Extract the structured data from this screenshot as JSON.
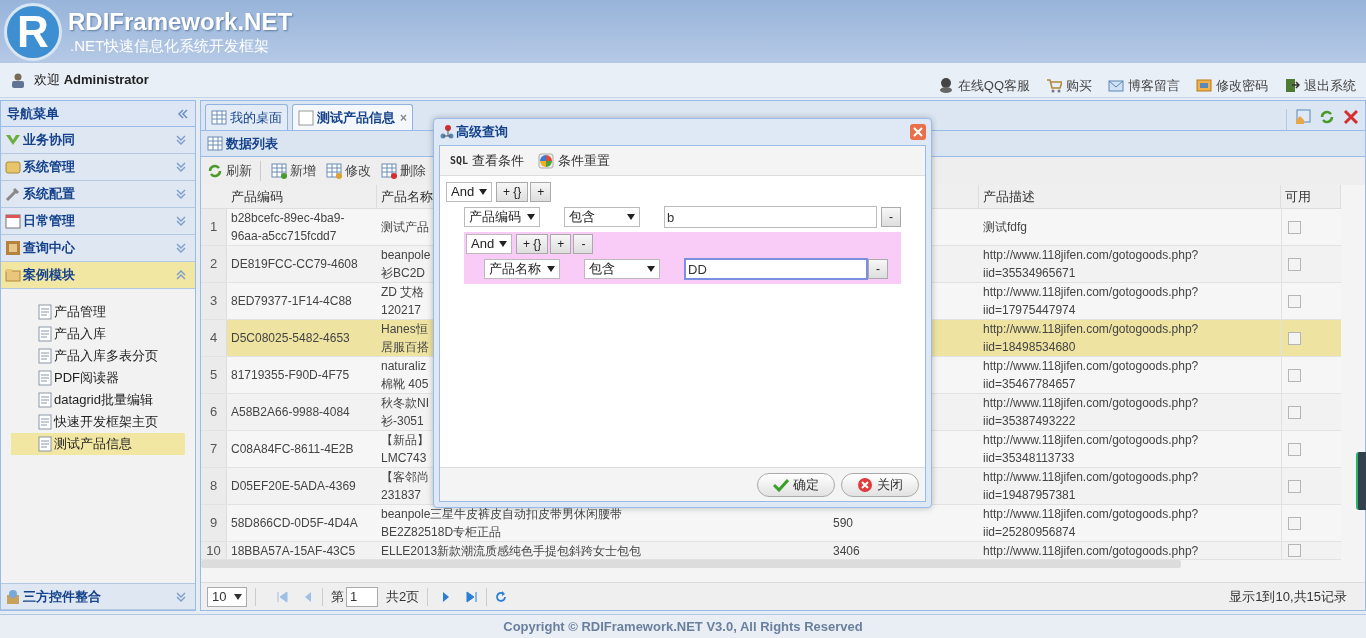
{
  "header": {
    "logo_letter": "R",
    "title": "RDIFramework.NET",
    "subtitle": ".NET快速信息化系统开发框架"
  },
  "welcome": "欢迎 **Administrator**",
  "top_links": [
    {
      "label": "在线QQ客服",
      "kind": "person"
    },
    {
      "label": "购买",
      "kind": "cart"
    },
    {
      "label": "博客留言",
      "kind": "mail"
    },
    {
      "label": "修改密码",
      "kind": "key"
    },
    {
      "label": "退出系统",
      "kind": "exit"
    }
  ],
  "sidebar": {
    "title": "导航菜单",
    "sections": [
      {
        "label": "业务协同",
        "expanded": false,
        "selected": false
      },
      {
        "label": "系统管理",
        "expanded": false,
        "selected": false
      },
      {
        "label": "系统配置",
        "expanded": false,
        "selected": false
      },
      {
        "label": "日常管理",
        "expanded": false,
        "selected": false
      },
      {
        "label": "查询中心",
        "expanded": false,
        "selected": false
      },
      {
        "label": "案例模块",
        "expanded": true,
        "selected": true,
        "items": [
          {
            "label": "产品管理",
            "selected": false
          },
          {
            "label": "产品入库",
            "selected": false
          },
          {
            "label": "产品入库多表分页",
            "selected": false
          },
          {
            "label": "PDF阅读器",
            "selected": false
          },
          {
            "label": "datagrid批量编辑",
            "selected": false
          },
          {
            "label": "快速开发框架主页",
            "selected": false
          },
          {
            "label": "测试产品信息",
            "selected": true
          }
        ]
      },
      {
        "label": "三方控件整合",
        "expanded": false,
        "selected": false
      }
    ]
  },
  "tabs": [
    {
      "label": "我的桌面",
      "selected": false
    },
    {
      "label": "测试产品信息",
      "selected": true,
      "close": "×"
    }
  ],
  "panel_title": "数据列表",
  "toolbar": [
    "刷新",
    "新增",
    "修改",
    "删除"
  ],
  "table": {
    "columns": [
      "产品编码",
      "产品名称",
      "",
      "",
      "产品描述",
      "可用"
    ],
    "rows": [
      {
        "num": "1",
        "code": [
          "b28bcefc-89ec-4ba9-",
          "96aa-a5cc715fcdd7"
        ],
        "name": [
          "测试产品"
        ],
        "column_4": "",
        "desc": [
          "测试fdfg"
        ],
        "checked": false,
        "selected": false
      },
      {
        "num": "2",
        "code": [
          "DE819FCC-CC79-4608"
        ],
        "name": [
          "beanpole",
          "衫BC2D"
        ],
        "column_4": "",
        "desc": [
          "http://www.118jifen.com/gotogoods.php?",
          "iid=35534965671"
        ],
        "checked": false,
        "selected": false
      },
      {
        "num": "3",
        "code": [
          "8ED79377-1F14-4C88"
        ],
        "name": [
          "ZD 艾格",
          "120217"
        ],
        "column_4": "",
        "desc": [
          "http://www.118jifen.com/gotogoods.php?",
          "iid=17975447974"
        ],
        "checked": false,
        "selected": false
      },
      {
        "num": "4",
        "code": [
          "D5C08025-5482-4653"
        ],
        "name": [
          "Hanes恒",
          "居服百搭"
        ],
        "column_4": "",
        "desc": [
          "http://www.118jifen.com/gotogoods.php?",
          "iid=18498534680"
        ],
        "checked": false,
        "selected": true
      },
      {
        "num": "5",
        "code": [
          "81719355-F90D-4F75"
        ],
        "name": [
          "naturaliz",
          "棉靴 405"
        ],
        "column_4": "",
        "desc": [
          "http://www.118jifen.com/gotogoods.php?",
          "iid=35467784657"
        ],
        "checked": false,
        "selected": false
      },
      {
        "num": "6",
        "code": [
          "A58B2A66-9988-4084"
        ],
        "name": [
          "秋冬款NI",
          "衫-3051"
        ],
        "column_4": "",
        "desc": [
          "http://www.118jifen.com/gotogoods.php?",
          "iid=35387493222"
        ],
        "checked": false,
        "selected": false
      },
      {
        "num": "7",
        "code": [
          "C08A84FC-8611-4E2B"
        ],
        "name": [
          "【新品】",
          "LMC743"
        ],
        "column_4": "",
        "desc": [
          "http://www.118jifen.com/gotogoods.php?",
          "iid=35348113733"
        ],
        "checked": false,
        "selected": false
      },
      {
        "num": "8",
        "code": [
          "D05EF20E-5ADA-4369"
        ],
        "name": [
          "【客邻尚",
          "231837"
        ],
        "column_4": "",
        "desc": [
          "http://www.118jifen.com/gotogoods.php?",
          "iid=19487957381"
        ],
        "checked": false,
        "selected": false
      },
      {
        "num": "9",
        "code": [
          "58D866CD-0D5F-4D4A"
        ],
        "name": [
          "beanpole三星牛皮裤皮自动扣皮带男休闲腰带",
          "BE2Z82518D专柜正品"
        ],
        "column_4": "590",
        "desc": [
          "http://www.118jifen.com/gotogoods.php?",
          "iid=25280956874"
        ],
        "checked": false,
        "selected": false
      },
      {
        "num": "10",
        "code": [
          "18BBA57A-15AF-43C5"
        ],
        "name": [
          "ELLE2013新款潮流质感纯色手提包斜跨女士包包"
        ],
        "column_4": "3406",
        "desc": [
          "http://www.118jifen.com/gotogoods.php?"
        ],
        "checked": false,
        "selected": false
      }
    ]
  },
  "pager": {
    "page_size": "10",
    "page_prefix": "第",
    "page": "1",
    "page_total": "共2页",
    "summary": "显示1到10,共15记录"
  },
  "dialog": {
    "title": "高级查询",
    "toolbar": [
      {
        "kind": "text_icon",
        "icon_text": "SQL",
        "label": "查看条件"
      },
      {
        "kind": "image_icon",
        "label": "条件重置"
      }
    ],
    "query": {
      "logic": "And",
      "buttons": [
        "+ {}",
        "+"
      ],
      "children": [
        {
          "kind": "condition",
          "field": "产品编码",
          "op": "包含",
          "value": "b",
          "focused": false,
          "remove": "-"
        },
        {
          "kind": "group",
          "logic": "And",
          "buttons": [
            "+ {}",
            "+",
            "-"
          ],
          "children": [
            {
              "kind": "condition",
              "field": "产品名称",
              "op": "包含",
              "value": "DD",
              "focused": true,
              "remove": "-"
            }
          ]
        }
      ]
    },
    "buttons": [
      {
        "kind": "ok",
        "label": "确定"
      },
      {
        "kind": "close",
        "label": "关闭"
      }
    ]
  },
  "footer": "Copyright © RDIFramework.NET V3.0, All Rights Reserved"
}
